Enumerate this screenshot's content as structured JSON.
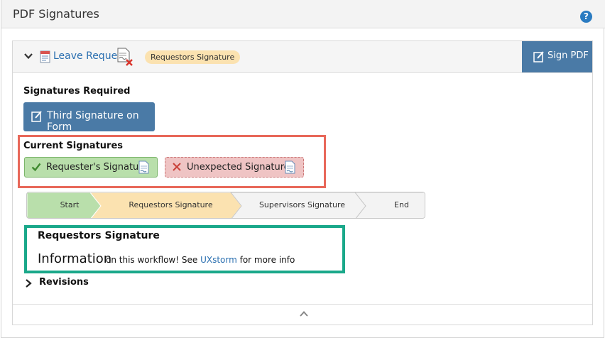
{
  "header": {
    "title": "PDF Signatures",
    "help_icon": "question-circle-icon"
  },
  "panel": {
    "document_link": "Leave Request",
    "status_badge": "Requestors Signature",
    "sign_pdf_label": "Sign PDF"
  },
  "signatures_required": {
    "title": "Signatures Required",
    "button_label": "Third Signature on Form"
  },
  "current_signatures": {
    "title": "Current Signatures",
    "items": [
      {
        "label": "Requester's Signature",
        "status": "valid",
        "color": "#b9dfab"
      },
      {
        "label": "Unexpected Signature",
        "status": "invalid",
        "color": "#efc4c4"
      }
    ]
  },
  "workflow": {
    "steps": [
      {
        "label": "Start",
        "state": "done",
        "color": "#b9dfab"
      },
      {
        "label": "Requestors Signature",
        "state": "current",
        "color": "#fbe2b0"
      },
      {
        "label": "Supervisors Signature",
        "state": "pending",
        "color": "#f3f3f3"
      },
      {
        "label": "End",
        "state": "pending",
        "color": "#f3f3f3"
      }
    ]
  },
  "info": {
    "title": "Requestors Signature",
    "big_text": "Information",
    "small_text": "on this workflow!  See",
    "link_text": "UXstorm",
    "tail_text": "for more info"
  },
  "revisions": {
    "label": "Revisions"
  },
  "highlight_colors": {
    "red_box": "#e8685a",
    "teal_box": "#1aa88a",
    "accent": "#4a7aa6"
  }
}
